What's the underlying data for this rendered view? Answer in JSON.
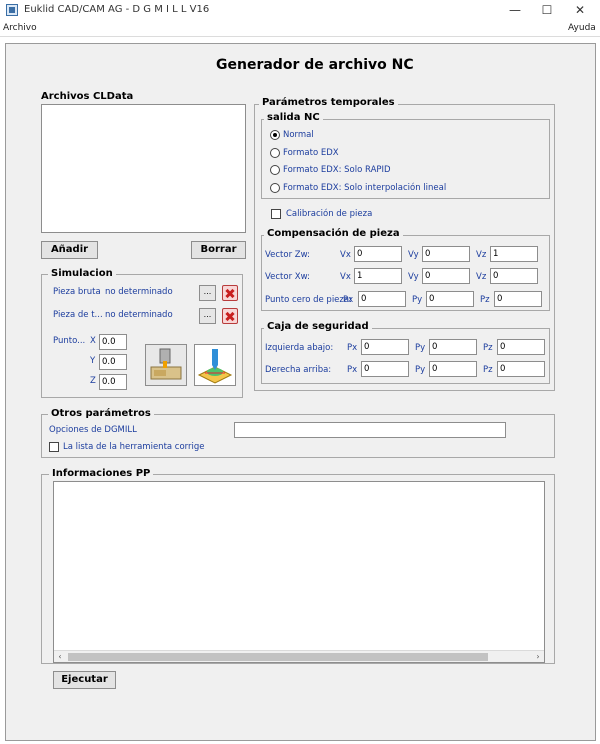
{
  "window": {
    "title": "Euklid CAD/CAM AG  -  D G M I L L  V16",
    "min": "—",
    "max": "☐",
    "close": "✕"
  },
  "menu": {
    "archivo": "Archivo",
    "ayuda": "Ayuda"
  },
  "page_title": "Generador de archivo NC",
  "clfiles": {
    "label": "Archivos CLData",
    "add_button": "Añadir",
    "delete_button": "Borrar"
  },
  "simulation": {
    "title": "Simulacion",
    "raw_label": "Pieza bruta",
    "raw_value": "no determinado",
    "part_label": "Pieza de t...",
    "part_value": "no determinado",
    "browse": "...",
    "point_label": "Punto...",
    "x_label": "X",
    "y_label": "Y",
    "z_label": "Z",
    "x": "0.0",
    "y": "0.0",
    "z": "0.0"
  },
  "temporal": {
    "title": "Parámetros temporales",
    "nc_output": {
      "title": "salida NC",
      "options": [
        "Normal",
        "Formato EDX",
        "Formato EDX: Solo RAPID",
        "Formato EDX: Solo interpolación lineal"
      ],
      "selected": "Normal"
    },
    "calibration": "Calibración de pieza"
  },
  "compensation": {
    "title": "Compensación de pieza",
    "zw_label": "Vector Zw:",
    "xw_label": "Vector Xw:",
    "zero_label": "Punto cero de pieza:",
    "vx": "Vx",
    "vy": "Vy",
    "vz": "Vz",
    "px": "Px",
    "py": "Py",
    "pz": "Pz",
    "zw": [
      "0",
      "0",
      "1"
    ],
    "xw": [
      "1",
      "0",
      "0"
    ],
    "zero": [
      "0",
      "0",
      "0"
    ]
  },
  "safety": {
    "title": "Caja de seguridad",
    "lower_label": "Izquierda abajo:",
    "upper_label": "Derecha arriba:",
    "px": "Px",
    "py": "Py",
    "pz": "Pz",
    "lower": [
      "0",
      "0",
      "0"
    ],
    "upper": [
      "0",
      "0",
      "0"
    ]
  },
  "other": {
    "title": "Otros parámetros",
    "options_label": "Opciones de DGMILL",
    "options_value": "",
    "tool_list": "La lista de la herramienta corrige"
  },
  "info": {
    "title": "Informaciones PP",
    "content": ""
  },
  "run_button": "Ejecutar"
}
